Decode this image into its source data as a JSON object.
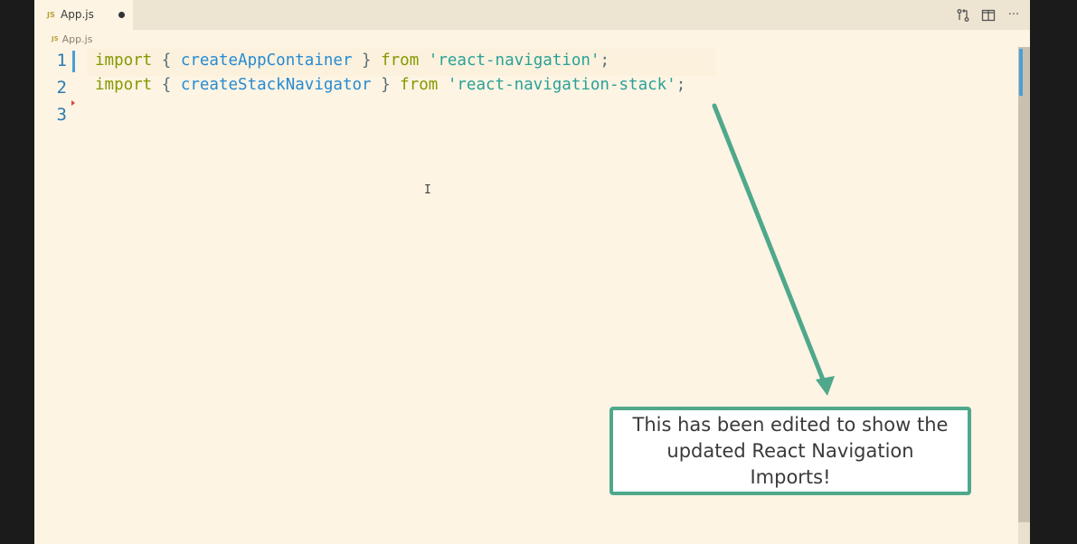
{
  "tab": {
    "badge": "JS",
    "filename": "App.js"
  },
  "tab_actions": {
    "compare_icon": "git-compare-icon",
    "split_icon": "split-editor-icon",
    "more_icon": "more-actions-icon",
    "more_glyph": "···"
  },
  "breadcrumb": {
    "badge": "JS",
    "label": "App.js"
  },
  "editor": {
    "line_numbers": [
      "1",
      "2",
      "3"
    ],
    "lines": [
      {
        "kw1": "import",
        "open": " { ",
        "ident": "createAppContainer",
        "close": " } ",
        "kw2": "from",
        "space": " ",
        "str": "'react-navigation'",
        "semi": ";"
      },
      {
        "kw1": "import",
        "open": " { ",
        "ident": "createStackNavigator",
        "close": " } ",
        "kw2": "from",
        "space": " ",
        "str": "'react-navigation-stack'",
        "semi": ";"
      }
    ],
    "ibeam_glyph": "I"
  },
  "callout": {
    "text": "This has been edited to show the updated React Navigation Imports!"
  },
  "colors": {
    "background": "#fdf4e3",
    "keyword": "#859900",
    "identifier": "#268bd2",
    "string": "#2aa198",
    "line_number": "#2b7ab2",
    "callout_border": "#4fa88b"
  }
}
